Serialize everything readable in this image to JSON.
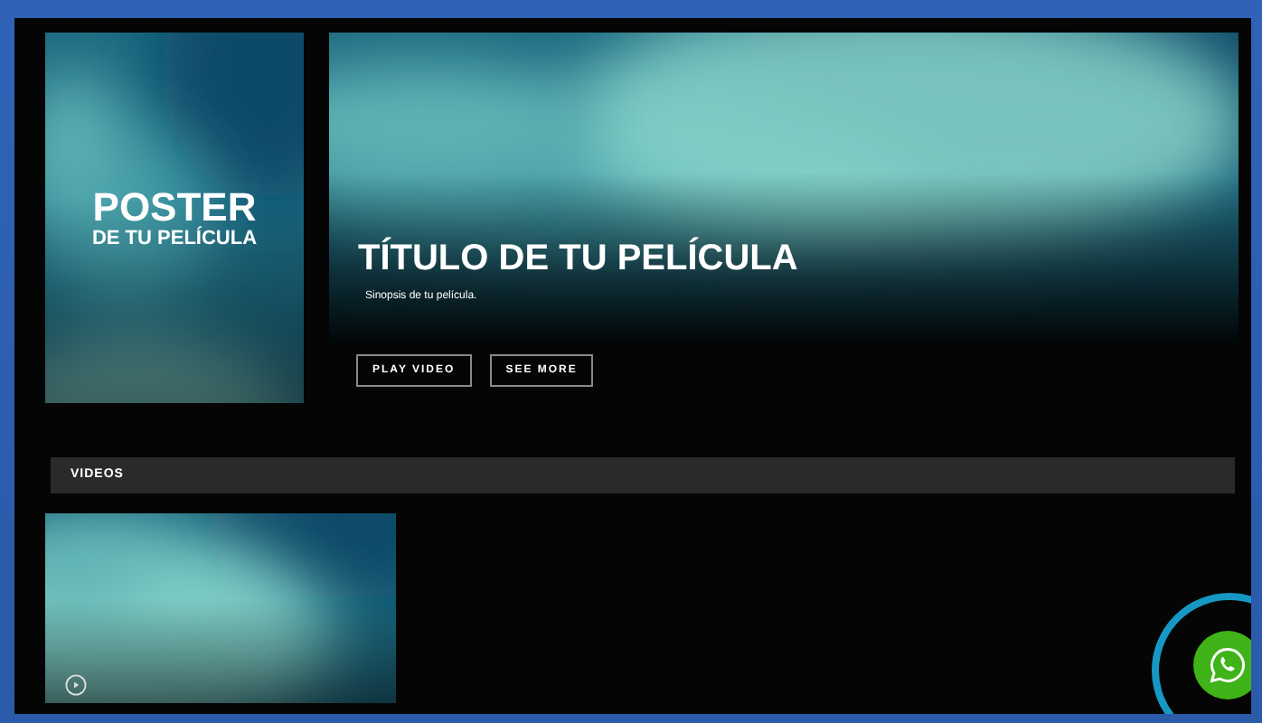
{
  "poster": {
    "title": "POSTER",
    "subtitle": "DE TU PELÍCULA"
  },
  "hero": {
    "title": "TÍTULO DE TU PELÍCULA",
    "synopsis": "Sinopsis de tu película."
  },
  "buttons": [
    "PLAY VIDEO",
    "SEE MORE"
  ],
  "videos": {
    "heading": "VIDEOS",
    "thumbnails": [
      {
        "kind": "landscape"
      }
    ]
  }
}
